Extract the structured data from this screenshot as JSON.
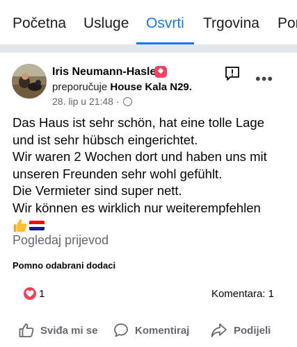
{
  "tabs": [
    {
      "label": "Početna",
      "active": false
    },
    {
      "label": "Usluge",
      "active": false
    },
    {
      "label": "Osvrti",
      "active": true
    },
    {
      "label": "Trgovina",
      "active": false
    },
    {
      "label": "Por",
      "active": false
    }
  ],
  "post": {
    "author": "Iris Neumann-Hasler",
    "recommends_verb": "preporučuje",
    "page_name": "House Kala N29.",
    "timestamp": "28. lip u 21:48",
    "dot": "·",
    "audience_icon": "globe-icon",
    "text_lines": [
      "Das Haus ist sehr schön, hat eine tolle Lage",
      "und ist sehr hübsch eingerichtet.",
      "Wir waren 2 Wochen dort und haben uns mit",
      "unseren Freunden sehr wohl gefühlt.",
      "Die Vermieter sind super nett.",
      "Wir können es wirklich nur weiterempfehlen"
    ],
    "emojis": [
      "thumbs-up-emoji",
      "croatia-flag-emoji"
    ],
    "translate_label": "Pogledaj prijevod",
    "addons_title": "Pomno odabrani dodaci"
  },
  "reactions": {
    "icon": "heart-icon",
    "count": "1",
    "comments_label": "Komentara: 1"
  },
  "actions": {
    "like_label": "Sviđa mi se",
    "comment_label": "Komentiraj",
    "share_label": "Podijeli"
  },
  "colors": {
    "accent": "#1877f2",
    "muted": "#65676b",
    "badge": "#f3425f",
    "heart": "#f33e58"
  }
}
